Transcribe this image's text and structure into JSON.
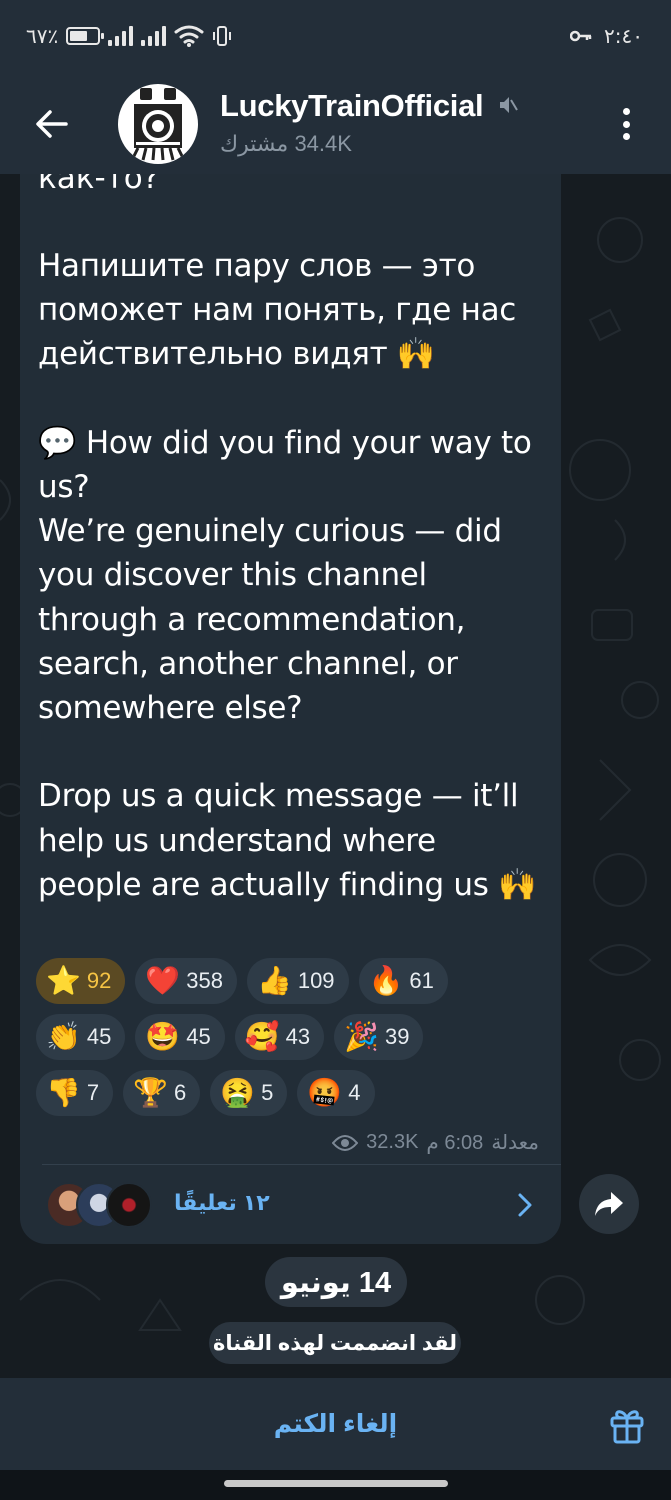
{
  "status_bar": {
    "battery_percent": "٦٧٪",
    "battery_level": 0.67,
    "time": "٢:٤٠"
  },
  "header": {
    "channel_name": "LuckyTrainOfficial",
    "subscribers": "34.4K مشترك",
    "icons": [
      "back-arrow-icon",
      "mute-icon",
      "more-vert-icon"
    ]
  },
  "message": {
    "top_partial": "как-то?",
    "text": "Напишите пару слов — это поможет нам понять, где нас действительно видят 🙌\n\n💬 How did you find your way to us?\nWe’re genuinely curious — did you discover this channel through a recommendation, search, another channel, or somewhere else?\n\nDrop us a quick message — it’ll help us understand where people are actually finding us 🙌",
    "reactions": [
      [
        {
          "emoji": "⭐",
          "count": "92",
          "highlight": true
        },
        {
          "emoji": "❤️",
          "count": "358"
        },
        {
          "emoji": "👍",
          "count": "109"
        },
        {
          "emoji": "🔥",
          "count": "61"
        }
      ],
      [
        {
          "emoji": "👏",
          "count": "45"
        },
        {
          "emoji": "🤩",
          "count": "45"
        },
        {
          "emoji": "🥰",
          "count": "43"
        },
        {
          "emoji": "🎉",
          "count": "39"
        }
      ],
      [
        {
          "emoji": "👎",
          "count": "7"
        },
        {
          "emoji": "🏆",
          "count": "6"
        },
        {
          "emoji": "🤮",
          "count": "5"
        },
        {
          "emoji": "🤬",
          "count": "4"
        }
      ]
    ],
    "views": "32.3K",
    "time": "6:08 م",
    "edited_label": "معدلة",
    "comments_label": "١٢ تعليقًا"
  },
  "date_chip": "14 يونيو",
  "service_message": "لقد انضممت لهذه القناة",
  "bottom_bar": {
    "unmute_label": "إلغاء الكتم"
  },
  "colors": {
    "accent": "#6ab3f3",
    "bubble": "#222d37",
    "header": "#232e39",
    "star_reaction": "#f6c444"
  }
}
